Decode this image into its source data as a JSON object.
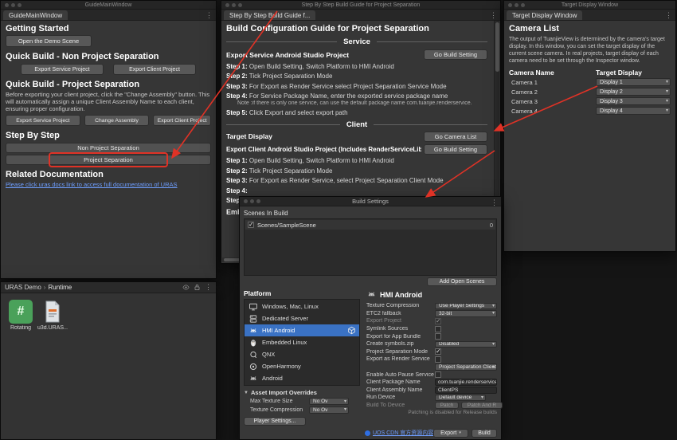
{
  "icons": {
    "kebab": "⋮",
    "caret": "▾",
    "breadcrumb_arrow": "›",
    "foldout": "▼",
    "hash": "#"
  },
  "colors": {
    "selection_blue": "#3a72c4",
    "annotation_red": "#e03226",
    "link_blue": "#6e9eff"
  },
  "guide_window": {
    "titlebar": "GuideMainWindow",
    "tab": "GuideMainWindow",
    "getting_started_heading": "Getting Started",
    "open_demo_button": "Open the Demo Scene",
    "quick_build_non_ps_heading": "Quick Build - Non Project Separation",
    "non_ps_buttons": [
      "Export Service Project",
      "Export Client Project"
    ],
    "quick_build_ps_heading": "Quick Build - Project Separation",
    "ps_description": "Before exporting your client project, click the \"Change Assembly\" button. This will automatically assign a unique Client Assembly Name to each client, ensuring proper configuration.",
    "ps_buttons": [
      "Export Service Project",
      "Change Assembly",
      "Export Client Project"
    ],
    "step_by_step_heading": "Step By Step",
    "step_buttons": [
      "Non Project Separation",
      "Project Separation"
    ],
    "related_docs_heading": "Related Documentation",
    "docs_link": "Please click uras docs link to access full documentation of URAS"
  },
  "steps_window": {
    "titlebar": "Step By Step Build Guide for Project Separation",
    "tab": "Step By Step Build Guide f...",
    "heading": "Build Configuration Guide for Project Separation",
    "service": {
      "divider": "Service",
      "subheading": "Export Service Android Studio Project",
      "button": "Go Build Setting",
      "steps": [
        {
          "label": "Step 1:",
          "text": "Open Build Setting, Switch Platform to HMI Android"
        },
        {
          "label": "Step 2:",
          "text": "Tick Project Separation Mode"
        },
        {
          "label": "Step 3:",
          "text": "For Export as Render Service select Project Separation Service Mode"
        },
        {
          "label": "Step 4:",
          "text": "For Service Package Name, enter the exported service package name"
        },
        {
          "label": "Step 5:",
          "text": "Click Export and select export path"
        }
      ],
      "note": "Note :if there is only one service, can use the default package name com.tuanjie.renderservice."
    },
    "client": {
      "divider": "Client",
      "target_display_heading": "Target Display",
      "camera_list_button": "Go Camera List",
      "subheading": "Export Client Android Studio Project (Includes RenderServiceLibrary)",
      "build_setting_button": "Go Build Setting",
      "steps": [
        {
          "label": "Step 1:",
          "text": "Open Build Setting, Switch Platform to HMI Android"
        },
        {
          "label": "Step 2:",
          "text": "Tick Project Separation Mode"
        },
        {
          "label": "Step 3:",
          "text": "For Export as Render Service, select Project Separation Client Mode"
        },
        {
          "label": "Step 4:",
          "text": ""
        },
        {
          "label": "Step 5:",
          "text": ""
        }
      ],
      "partial_heading": "Emb"
    }
  },
  "target_window": {
    "titlebar": "Target Display Window",
    "tab": "Target Display Window",
    "heading": "Camera List",
    "description": "The output of TuanjieView is determined by the camera's target display. In this window, you can set the target display of the current scene camera. In real projects, target display of each camera need to be set through the Inspector window.",
    "columns": {
      "name": "Camera Name",
      "display": "Target Display"
    },
    "cameras": [
      {
        "name": "Camera 1",
        "display": "Display 1"
      },
      {
        "name": "Camera 2",
        "display": "Display 2"
      },
      {
        "name": "Camera 3",
        "display": "Display 3"
      },
      {
        "name": "Camera 4",
        "display": "Display 4"
      }
    ]
  },
  "build_settings": {
    "titlebar": "Build Settings",
    "scenes_header": "Scenes In Build",
    "scene_row": {
      "name": "Scenes/SampleScene",
      "index": "0",
      "checked": true
    },
    "add_open_scenes_button": "Add Open Scenes",
    "platform_header": "Platform",
    "platforms": [
      {
        "name": "Windows, Mac, Linux"
      },
      {
        "name": "Dedicated Server"
      },
      {
        "name": "HMI Android",
        "selected": true
      },
      {
        "name": "Embedded Linux"
      },
      {
        "name": "QNX"
      },
      {
        "name": "OpenHarmony"
      },
      {
        "name": "Android"
      }
    ],
    "panel_header": "HMI Android",
    "settings": [
      {
        "label": "Texture Compression",
        "type": "dropdown",
        "value": "Use Player Settings"
      },
      {
        "label": "ETC2 fallback",
        "type": "dropdown",
        "value": "32-bit"
      },
      {
        "label": "Export Project",
        "type": "checkbox",
        "checked": true,
        "disabled": true
      },
      {
        "label": "Symlink Sources",
        "type": "checkbox",
        "checked": false
      },
      {
        "label": "Export for App Bundle",
        "type": "checkbox",
        "checked": false
      },
      {
        "label": "Create symbols.zip",
        "type": "dropdown",
        "value": "Disabled"
      },
      {
        "label": "Project Separation Mode",
        "type": "checkbox",
        "checked": true
      },
      {
        "label": "Export as Render Service",
        "type": "checkbox",
        "checked": false
      },
      {
        "label": "",
        "type": "dropdown",
        "value": "Project Separation Client Mode"
      },
      {
        "label": "Enable Auto Pause Service",
        "type": "checkbox",
        "checked": false
      },
      {
        "label": "Client Package Name",
        "type": "text",
        "value": "com.tuanjie.renderserviceclient"
      },
      {
        "label": "Client Assembly Name",
        "type": "text",
        "value": "ClientPS"
      },
      {
        "label": "Run Device",
        "type": "dropdown",
        "value": "Default device"
      },
      {
        "label": "Build To Device",
        "type": "label",
        "disabled": true
      }
    ],
    "patch_button": "Patch",
    "patch_and_run_button": "Patch And R",
    "patch_note": "Patching is disabled for Release builds",
    "asset_overrides": {
      "header": "Asset Import Overrides",
      "rows": [
        {
          "label": "Max Texture Size",
          "value": "No Ov"
        },
        {
          "label": "Texture Compression",
          "value": "No Ov"
        }
      ],
      "player_settings_button": "Player Settings..."
    },
    "footer": {
      "uos_link": "UOS CDN 官方资源内容分发,提速降本",
      "export_button": "Export",
      "build_button": "Build"
    }
  },
  "project_browser": {
    "breadcrumb": {
      "root": "URAS Demo",
      "current": "Runtime"
    },
    "assets": [
      {
        "name": "Rotating"
      },
      {
        "name": "u3d.URAS..."
      }
    ]
  }
}
